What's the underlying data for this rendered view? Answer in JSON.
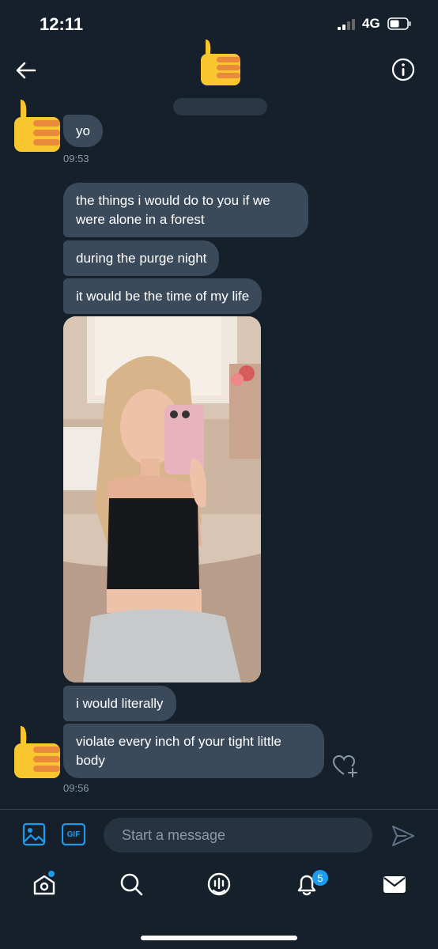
{
  "status_bar": {
    "time": "12:11",
    "network": "4G"
  },
  "header": {
    "back_icon": "arrow-left-icon",
    "avatar_icon": "thumbs-up-emoji",
    "info_icon": "info-icon"
  },
  "messages": [
    {
      "text": "yo"
    },
    {
      "text": "the things i would do to you if we were alone in a forest"
    },
    {
      "text": "during the purge night"
    },
    {
      "text": "it would be the time of my life"
    },
    {
      "text": "i would literally"
    },
    {
      "text": "violate every inch of your tight little body"
    }
  ],
  "timestamps": [
    "09:53",
    "09:56"
  ],
  "composer": {
    "placeholder": "Start a message",
    "gif_label": "GIF"
  },
  "bottom_nav": {
    "notifications_badge": "5"
  },
  "colors": {
    "background": "#15202b",
    "bubble": "#3b4a5a",
    "accent": "#1d9bf0",
    "muted_text": "#8b98a5"
  }
}
